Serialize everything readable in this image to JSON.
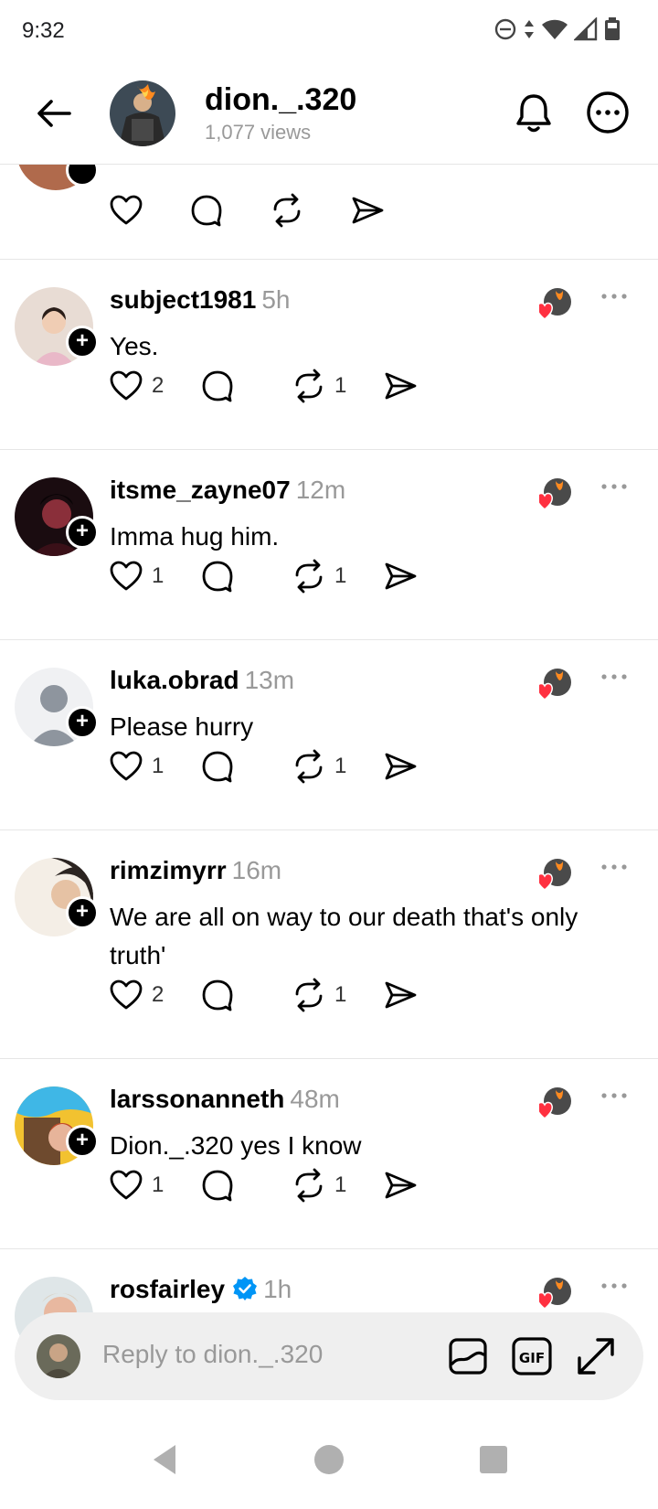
{
  "status": {
    "time": "9:32"
  },
  "header": {
    "title": "dion._.320",
    "views": "1,077 views"
  },
  "comments": [
    {
      "user": "subject1981",
      "time": "5h",
      "text": "Yes.",
      "likes": "2",
      "comments": "",
      "reposts": "1"
    },
    {
      "user": "itsme_zayne07",
      "time": "12m",
      "text": "Imma hug him.",
      "likes": "1",
      "comments": "",
      "reposts": "1"
    },
    {
      "user": "luka.obrad",
      "time": "13m",
      "text": "Please hurry",
      "likes": "1",
      "comments": "",
      "reposts": "1"
    },
    {
      "user": "rimzimyrr",
      "time": "16m",
      "text": "We are all on way to our death that's only truth'",
      "likes": "2",
      "comments": "",
      "reposts": "1"
    },
    {
      "user": "larssonanneth",
      "time": "48m",
      "text": "Dion._.320 yes I know",
      "likes": "1",
      "comments": "",
      "reposts": "1"
    },
    {
      "user": "rosfairley",
      "time": "1h",
      "text": "",
      "verified": true
    }
  ],
  "reply": {
    "placeholder": "Reply to dion._.320"
  },
  "colors": {
    "heart_red": "#ff3040",
    "verified_blue": "#0095f6",
    "muted": "#999999",
    "divider": "#e6e6e6"
  }
}
